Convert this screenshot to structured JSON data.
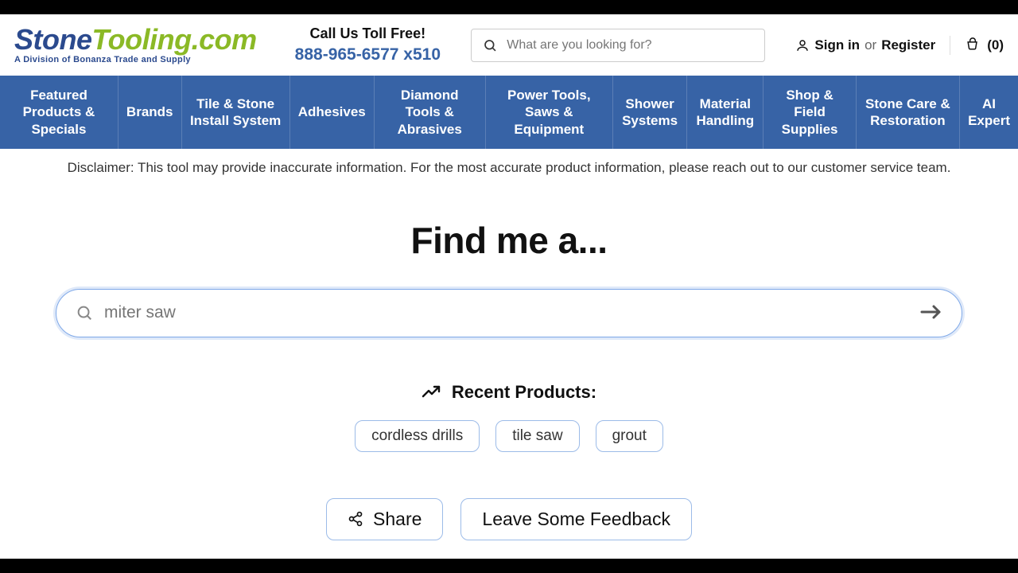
{
  "logo": {
    "part1": "Stone",
    "part2": "Tooling.com",
    "sub": "A Division of Bonanza Trade and Supply"
  },
  "call": {
    "label": "Call Us Toll Free!",
    "phone": "888-965-6577 x510"
  },
  "header_search": {
    "placeholder": "What are you looking for?"
  },
  "auth": {
    "signin": "Sign in",
    "or": "or",
    "register": "Register"
  },
  "cart": {
    "count_display": "(0)"
  },
  "nav": [
    "Featured Products & Specials",
    "Brands",
    "Tile & Stone Install System",
    "Adhesives",
    "Diamond Tools & Abrasives",
    "Power Tools, Saws & Equipment",
    "Shower Systems",
    "Material Handling",
    "Shop & Field Supplies",
    "Stone Care & Restoration",
    "AI Expert"
  ],
  "disclaimer": "Disclaimer: This tool may provide inaccurate information. For the most accurate product information, please reach out to our customer service team.",
  "main": {
    "heading": "Find me a...",
    "search_placeholder": "miter saw",
    "recent_label": "Recent Products:",
    "recent": [
      "cordless drills",
      "tile saw",
      "grout"
    ],
    "share": "Share",
    "feedback": "Leave Some Feedback"
  }
}
